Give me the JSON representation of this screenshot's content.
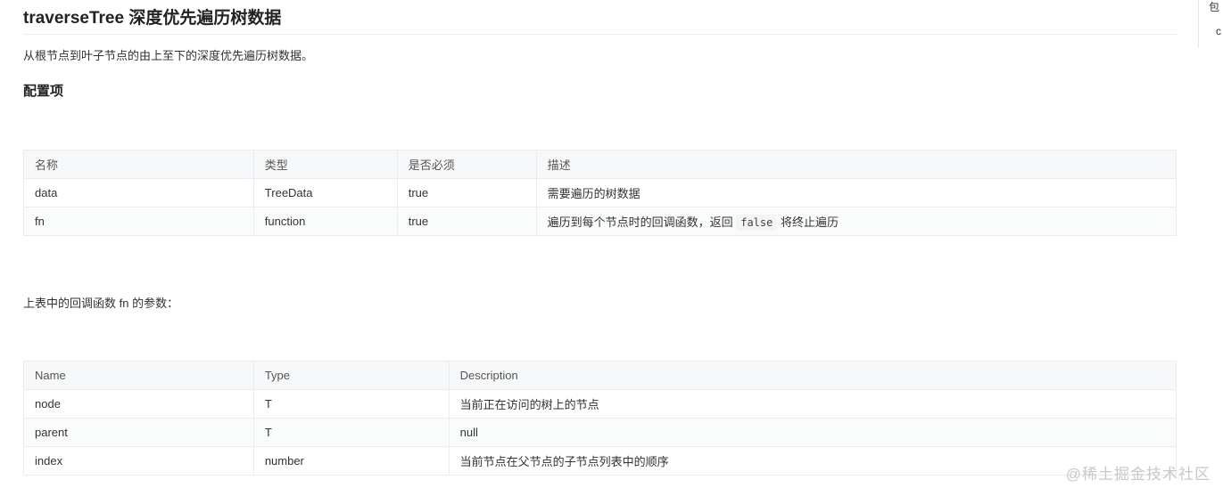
{
  "doc": {
    "title": "traverseTree 深度优先遍历树数据",
    "description": "从根节点到叶子节点的由上至下的深度优先遍历树数据。",
    "section_title": "配置项",
    "note": "上表中的回调函数 fn 的参数："
  },
  "options_table": {
    "headers": [
      "名称",
      "类型",
      "是否必须",
      "描述"
    ],
    "rows": [
      {
        "name": "data",
        "type": "TreeData",
        "required": "true",
        "desc": "需要遍历的树数据"
      },
      {
        "name": "fn",
        "type": "function",
        "required": "true",
        "desc_before": "遍历到每个节点时的回调函数，返回",
        "desc_code": "false",
        "desc_after": "将终止遍历"
      }
    ]
  },
  "params_table": {
    "headers": [
      "Name",
      "Type",
      "Description"
    ],
    "rows": [
      {
        "name": "node",
        "type": "T",
        "desc": "当前正在访问的树上的节点"
      },
      {
        "name": "parent",
        "type": "T",
        "desc": "null"
      },
      {
        "name": "index",
        "type": "number",
        "desc": "当前节点在父节点的子节点列表中的顺序"
      }
    ]
  },
  "sidebar": {
    "line1": "包",
    "line2": "c"
  },
  "watermark": "@稀土掘金技术社区"
}
